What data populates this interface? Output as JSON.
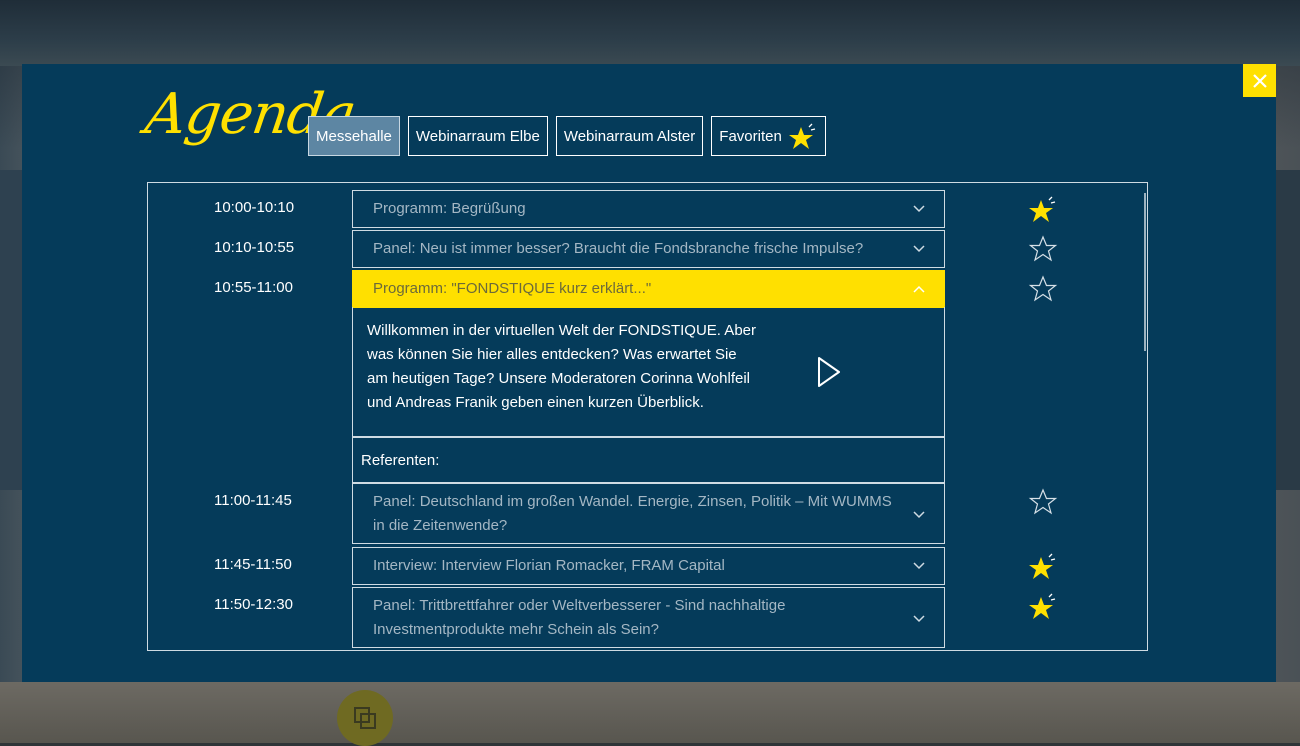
{
  "modal": {
    "title": "Agenda",
    "close_icon": "close-icon"
  },
  "tabs": [
    {
      "label": "Messehalle",
      "active": true
    },
    {
      "label": "Webinarraum Elbe",
      "active": false
    },
    {
      "label": "Webinarraum Alster",
      "active": false
    },
    {
      "label": "Favoriten",
      "active": false,
      "icon": "star-icon"
    }
  ],
  "sessions": [
    {
      "time": "10:00-10:10",
      "title": "Programm: Begrüßung",
      "favorite": true,
      "expanded": false
    },
    {
      "time": "10:10-10:55",
      "title": "Panel: Neu ist immer besser? Braucht die Fondsbranche frische Impulse?",
      "favorite": false,
      "expanded": false
    },
    {
      "time": "10:55-11:00",
      "title": "Programm: \"FONDSTIQUE kurz erklärt...\"",
      "favorite": false,
      "expanded": true
    },
    {
      "time": "11:00-11:45",
      "title": "Panel: Deutschland im großen Wandel. Energie, Zinsen, Politik – Mit WUMMS in die Zeitenwende?",
      "favorite": false,
      "expanded": false
    },
    {
      "time": "11:45-11:50",
      "title": "Interview: Interview Florian Romacker, FRAM Capital",
      "favorite": true,
      "expanded": false
    },
    {
      "time": "11:50-12:30",
      "title": "Panel: Trittbrettfahrer oder Weltverbesserer - Sind nachhaltige Investmentprodukte mehr Schein als Sein?",
      "favorite": true,
      "expanded": false
    }
  ],
  "expanded_detail": {
    "description": "Willkommen in der virtuellen Welt der FONDSTIQUE. Aber was können Sie hier alles entdecken? Was erwartet Sie am heutigen Tage? Unsere Moderatoren Corinna Wohlfeil und Andreas Franik geben einen kurzen Überblick.",
    "speakers_label": "Referenten:",
    "play_icon": "play-icon"
  },
  "colors": {
    "modal_bg": "#053b5a",
    "accent": "#ffe000",
    "tab_active": "#5d86a3"
  }
}
